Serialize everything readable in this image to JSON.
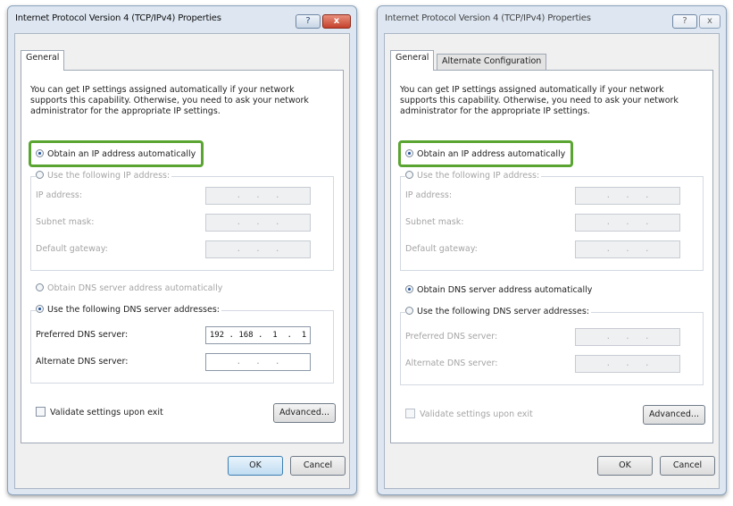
{
  "dialogs": [
    {
      "title": "Internet Protocol Version 4 (TCP/IPv4) Properties",
      "help_glyph": "?",
      "close_glyph": "x",
      "tabs": [
        "General"
      ],
      "intro": "You can get IP settings assigned automatically if your network supports this capability. Otherwise, you need to ask your network administrator for the appropriate IP settings.",
      "obtain_ip_auto": "Obtain an IP address automatically",
      "use_following_ip": "Use the following IP address:",
      "ip_address_label": "IP address:",
      "subnet_mask_label": "Subnet mask:",
      "default_gateway_label": "Default gateway:",
      "ip_address_value": " .   .   . ",
      "subnet_mask_value": " .   .   . ",
      "default_gateway_value": " .   .   . ",
      "obtain_dns_auto": "Obtain DNS server address automatically",
      "use_following_dns": "Use the following DNS server addresses:",
      "preferred_dns_label": "Preferred DNS server:",
      "alternate_dns_label": "Alternate DNS server:",
      "preferred_dns_value": "192 . 168 .  1  .  1",
      "alternate_dns_value": " .   .   . ",
      "validate_label": "Validate settings upon exit",
      "advanced_label": "Advanced...",
      "ok_label": "OK",
      "cancel_label": "Cancel"
    },
    {
      "title": "Internet Protocol Version 4 (TCP/IPv4) Properties",
      "help_glyph": "?",
      "close_glyph": "x",
      "tabs": [
        "General",
        "Alternate Configuration"
      ],
      "intro": "You can get IP settings assigned automatically if your network supports this capability. Otherwise, you need to ask your network administrator for the appropriate IP settings.",
      "obtain_ip_auto": "Obtain an IP address automatically",
      "use_following_ip": "Use the following IP address:",
      "ip_address_label": "IP address:",
      "subnet_mask_label": "Subnet mask:",
      "default_gateway_label": "Default gateway:",
      "ip_address_value": " .   .   . ",
      "subnet_mask_value": " .   .   . ",
      "default_gateway_value": " .   .   . ",
      "obtain_dns_auto": "Obtain DNS server address automatically",
      "use_following_dns": "Use the following DNS server addresses:",
      "preferred_dns_label": "Preferred DNS server:",
      "alternate_dns_label": "Alternate DNS server:",
      "preferred_dns_value": " .   .   . ",
      "alternate_dns_value": " .   .   . ",
      "validate_label": "Validate settings upon exit",
      "advanced_label": "Advanced...",
      "ok_label": "OK",
      "cancel_label": "Cancel"
    }
  ],
  "colors": {
    "highlight_outline": "#5aa531",
    "title_bar": "#dde6f1",
    "close_button": "#c4412b"
  }
}
